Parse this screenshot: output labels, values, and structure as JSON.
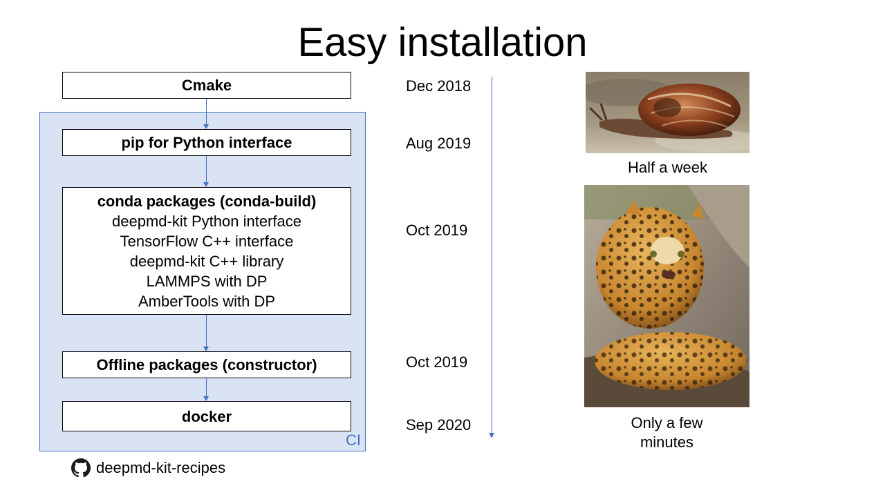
{
  "title": "Easy installation",
  "ci_label": "CI",
  "steps": [
    {
      "heading": "Cmake",
      "lines": []
    },
    {
      "heading": "pip for Python interface",
      "lines": []
    },
    {
      "heading": "conda packages (conda-build)",
      "lines": [
        "deepmd-kit Python interface",
        "TensorFlow C++ interface",
        "deepmd-kit C++ library",
        "LAMMPS with DP",
        "AmberTools with DP"
      ]
    },
    {
      "heading": "Offline packages (constructor)",
      "lines": []
    },
    {
      "heading": "docker",
      "lines": []
    }
  ],
  "timeline": [
    "Dec 2018",
    "Aug 2019",
    "Oct 2019",
    "Oct 2019",
    "Sep 2020"
  ],
  "snail": {
    "icon": "snail-photo",
    "caption": "Half a week"
  },
  "leopard": {
    "icon": "leopard-photo",
    "caption_line1": "Only a few",
    "caption_line2": "minutes"
  },
  "github": {
    "icon": "github-icon",
    "label": "deepmd-kit-recipes"
  },
  "colors": {
    "accent": "#4472c4",
    "panel": "#dae3f3"
  }
}
